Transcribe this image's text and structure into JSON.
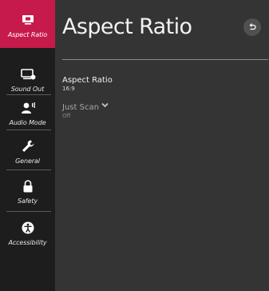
{
  "sidebar": {
    "items": [
      {
        "label": "Aspect Ratio",
        "icon": "aspect-ratio-icon",
        "active": true
      },
      {
        "label": "Sound Out",
        "icon": "sound-out-icon",
        "active": false
      },
      {
        "label": "Audio Mode",
        "icon": "audio-mode-icon",
        "active": false
      },
      {
        "label": "General",
        "icon": "wrench-icon",
        "active": false
      },
      {
        "label": "Safety",
        "icon": "lock-icon",
        "active": false
      },
      {
        "label": "Accessibility",
        "icon": "accessibility-icon",
        "active": false
      }
    ]
  },
  "header": {
    "title": "Aspect Ratio",
    "back_icon": "back-icon"
  },
  "settings": [
    {
      "label": "Aspect Ratio",
      "value": "16:9"
    },
    {
      "label": "Just Scan",
      "value": "Off",
      "icon": "chevron-down-icon"
    }
  ],
  "colors": {
    "accent": "#c61a4b",
    "sidebar_bg": "#1d1d1d",
    "panel_bg": "#343434"
  }
}
